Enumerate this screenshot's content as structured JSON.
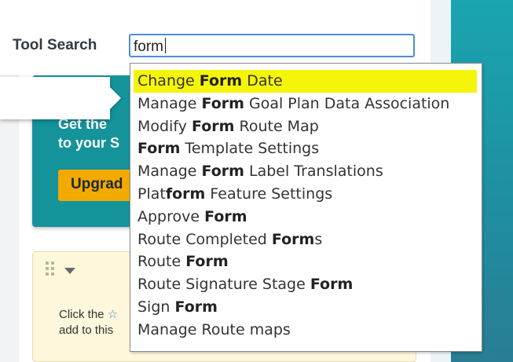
{
  "toolbar": {
    "search_label": "Tool Search",
    "search_value": "form"
  },
  "promo": {
    "text_line1": "Get the",
    "text_line2": "to your S",
    "button_label": "Upgrad"
  },
  "tile": {
    "text_line1_before": "Click the",
    "text_line2": "add to this"
  },
  "dropdown": {
    "active_index": 0,
    "items": [
      {
        "pre": "Change ",
        "match": "Form",
        "post": " Date"
      },
      {
        "pre": "Manage ",
        "match": "Form",
        "post": " Goal Plan Data Association"
      },
      {
        "pre": "Modify ",
        "match": "Form",
        "post": " Route Map"
      },
      {
        "pre": "",
        "match": "Form",
        "post": " Template Settings"
      },
      {
        "pre": "Manage ",
        "match": "Form",
        "post": " Label Translations"
      },
      {
        "pre": "Plat",
        "match": "form",
        "post": " Feature Settings"
      },
      {
        "pre": "Approve ",
        "match": "Form",
        "post": ""
      },
      {
        "pre": "Route Completed ",
        "match": "Form",
        "post": "s"
      },
      {
        "pre": "Route ",
        "match": "Form",
        "post": ""
      },
      {
        "pre": "Route Signature Stage ",
        "match": "Form",
        "post": ""
      },
      {
        "pre": "Sign ",
        "match": "Form",
        "post": ""
      },
      {
        "pre": "Manage Route maps",
        "match": "",
        "post": ""
      }
    ]
  },
  "colors": {
    "highlight": "#f5f50a",
    "accent_teal": "#14939b",
    "upgrade_button": "#f2a900",
    "search_border": "#4a8fd6"
  }
}
